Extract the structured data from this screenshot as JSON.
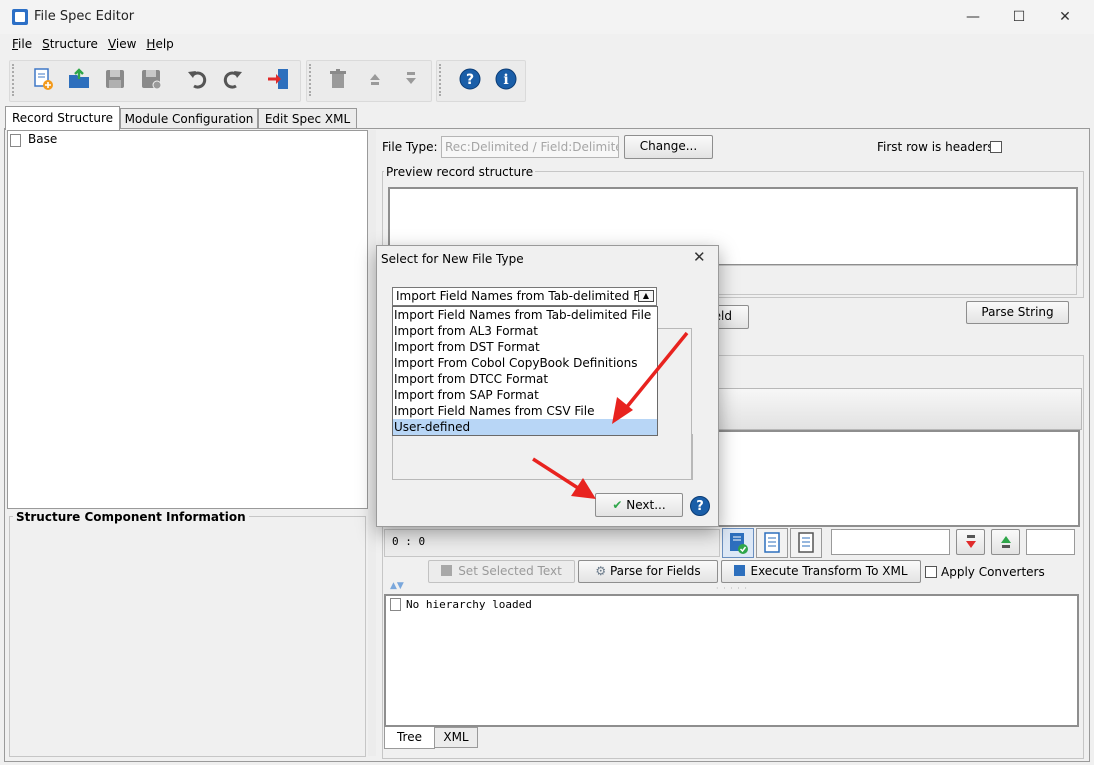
{
  "window": {
    "title": "File Spec Editor",
    "minimize": "—",
    "maximize": "☐",
    "close": "✕"
  },
  "menu": [
    {
      "mnemonic": "F",
      "rest": "ile"
    },
    {
      "mnemonic": "S",
      "rest": "tructure"
    },
    {
      "mnemonic": "V",
      "rest": "iew"
    },
    {
      "mnemonic": "H",
      "rest": "elp"
    }
  ],
  "toolbar_icons": [
    "new-file-icon",
    "open-file-icon",
    "save-icon",
    "save-as-icon",
    "undo-icon",
    "redo-icon",
    "exit-icon",
    "delete-icon",
    "move-up-icon",
    "move-down-icon",
    "help-icon",
    "info-icon"
  ],
  "tabs": [
    "Record Structure",
    "Module Configuration",
    "Edit Spec XML"
  ],
  "tree": {
    "root": "Base"
  },
  "structure_info": {
    "title": "Structure Component Information"
  },
  "file_type": {
    "label": "File Type:",
    "value": "Rec:Delimited / Field:Delimited",
    "change_button": "Change...",
    "first_row_label": "First row is headers"
  },
  "preview": {
    "title": "Preview record structure",
    "parse_string_button": "Parse String",
    "field_button_partial": "eld"
  },
  "bottom": {
    "position": "0 : 0",
    "set_selected_text": "Set Selected Text",
    "parse_for_fields": "Parse for Fields",
    "execute_transform": "Execute Transform To XML",
    "apply_converters": "Apply Converters",
    "hierarchy_text": "No hierarchy loaded",
    "tree_tab": "Tree",
    "xml_tab": "XML"
  },
  "dialog": {
    "title": "Select for New File Type",
    "selected_value": "Import Field Names from Tab-delimited File",
    "options": [
      "Import Field Names from Tab-delimited File",
      "Import from AL3 Format",
      "Import from DST Format",
      "Import From Cobol CopyBook Definitions",
      "Import from DTCC Format",
      "Import from SAP Format",
      "Import Field Names from CSV File",
      "User-defined"
    ],
    "highlighted_option": "User-defined",
    "next_button": "Next...",
    "help": "?"
  },
  "colors": {
    "annotation_arrow": "#e8231f",
    "selection": "#b8d6f6",
    "help_blue": "#1a5ea8"
  }
}
